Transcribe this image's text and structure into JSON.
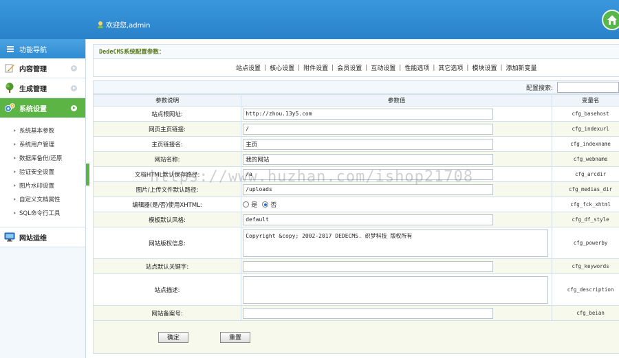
{
  "header": {
    "welcome": "欢迎您,admin"
  },
  "sidebar": {
    "title": "功能导航",
    "groups": [
      {
        "label": "内容管理"
      },
      {
        "label": "生成管理"
      },
      {
        "label": "系统设置"
      },
      {
        "label": "网站运维"
      }
    ],
    "sub_items": [
      "系统基本参数",
      "系统用户管理",
      "数据库备份/还原",
      "验证安全设置",
      "图片水印设置",
      "自定义文档属性",
      "SQL命令行工具"
    ]
  },
  "main": {
    "title": "DedeCMS系统配置参数：",
    "tabs": [
      "站点设置",
      "核心设置",
      "附件设置",
      "会员设置",
      "互动设置",
      "性能选项",
      "其它选项",
      "模块设置",
      "添加新变量"
    ],
    "search_label": "配置搜索:",
    "columns": [
      "参数说明",
      "参数值",
      "变量名"
    ],
    "rows": [
      {
        "label": "站点根网址:",
        "value": "http://zhou.13y5.com",
        "var": "cfg_basehost"
      },
      {
        "label": "网页主页链接:",
        "value": "/",
        "var": "cfg_indexurl"
      },
      {
        "label": "主页链接名:",
        "value": "主页",
        "var": "cfg_indexname"
      },
      {
        "label": "网站名称:",
        "value": "我的网站",
        "var": "cfg_webname"
      },
      {
        "label": "文档HTML默认保存路径:",
        "value": "/a",
        "var": "cfg_arcdir"
      },
      {
        "label": "图片/上传文件默认路径:",
        "value": "/uploads",
        "var": "cfg_medias_dir"
      },
      {
        "label": "编辑器(是/否)使用XHTML:",
        "opt_yes": "是",
        "opt_no": "否",
        "var": "cfg_fck_xhtml"
      },
      {
        "label": "模板默认风格:",
        "value": "default",
        "var": "cfg_df_style"
      },
      {
        "label": "网站版权信息:",
        "value": "Copyright &copy; 2002-2017 DEDECMS. 织梦科技 版权所有",
        "var": "cfg_powerby"
      },
      {
        "label": "站点默认关键字:",
        "value": "",
        "var": "cfg_keywords"
      },
      {
        "label": "站点描述:",
        "value": "",
        "var": "cfg_description"
      },
      {
        "label": "网站备案号:",
        "value": "",
        "var": "cfg_beian"
      }
    ],
    "buttons": {
      "ok": "确定",
      "reset": "重置"
    }
  },
  "watermark": "https://www.huzhan.com/ishop21708"
}
